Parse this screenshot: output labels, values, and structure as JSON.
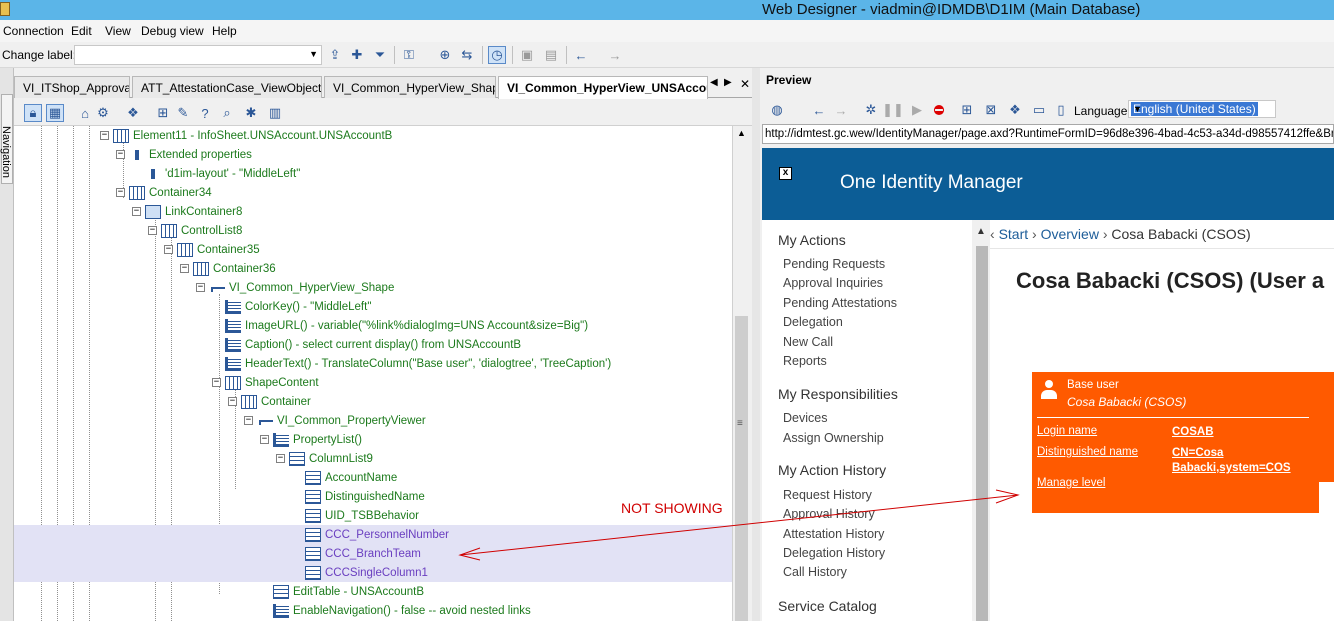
{
  "window": {
    "title": "Web Designer - viadmin@IDMDB\\D1IM (Main Database)"
  },
  "menu": {
    "items": [
      "Connection",
      "Edit",
      "View",
      "Debug view",
      "Help"
    ]
  },
  "label_row": {
    "label": "Change label:",
    "value": ""
  },
  "navigation": {
    "label": "Navigation"
  },
  "tabs": [
    {
      "label": "VI_ITShop_Approvals",
      "active": false
    },
    {
      "label": "ATT_AttestationCase_ViewObjects",
      "active": false
    },
    {
      "label": "VI_Common_HyperView_Shape",
      "active": false
    },
    {
      "label": "VI_Common_HyperView_UNSAccou",
      "active": true
    }
  ],
  "tree": [
    {
      "text": "Element11 - InfoSheet.UNSAccount.UNSAccountB",
      "icon": "grid",
      "purple": false
    },
    {
      "text": "Extended properties",
      "icon": "prop",
      "purple": false
    },
    {
      "text": "'d1im-layout' - \"MiddleLeft\"",
      "icon": "prop",
      "purple": false
    },
    {
      "text": "Container34",
      "icon": "grid",
      "purple": false
    },
    {
      "text": "LinkContainer8",
      "icon": "link",
      "purple": false
    },
    {
      "text": "ControlList8",
      "icon": "grid",
      "purple": false
    },
    {
      "text": "Container35",
      "icon": "grid",
      "purple": false
    },
    {
      "text": "Container36",
      "icon": "grid",
      "purple": false
    },
    {
      "text": "VI_Common_HyperView_Shape",
      "icon": "shape",
      "purple": false
    },
    {
      "text": "ColorKey() - \"MiddleLeft\"",
      "icon": "func",
      "purple": false
    },
    {
      "text": "ImageURL() - variable(\"%link%dialogImg=UNS Account&size=Big\")",
      "icon": "func",
      "purple": false
    },
    {
      "text": "Caption() - select current display() from UNSAccountB",
      "icon": "func",
      "purple": false
    },
    {
      "text": "HeaderText() - TranslateColumn(\"Base user\", 'dialogtree', 'TreeCaption')",
      "icon": "func",
      "purple": false
    },
    {
      "text": "ShapeContent",
      "icon": "grid",
      "purple": false
    },
    {
      "text": "Container",
      "icon": "grid",
      "purple": false
    },
    {
      "text": "VI_Common_PropertyViewer",
      "icon": "shape",
      "purple": false
    },
    {
      "text": "PropertyList()",
      "icon": "func",
      "purple": false
    },
    {
      "text": "ColumnList9",
      "icon": "col",
      "purple": false
    },
    {
      "text": "AccountName",
      "icon": "col",
      "purple": false
    },
    {
      "text": "DistinguishedName",
      "icon": "col",
      "purple": false
    },
    {
      "text": "UID_TSBBehavior",
      "icon": "col",
      "purple": false
    },
    {
      "text": "CCC_PersonnelNumber",
      "icon": "col",
      "purple": true
    },
    {
      "text": "CCC_BranchTeam",
      "icon": "col",
      "purple": true
    },
    {
      "text": "CCCSingleColumn1",
      "icon": "col",
      "purple": true
    },
    {
      "text": "EditTable - UNSAccountB",
      "icon": "col",
      "purple": false
    },
    {
      "text": "EnableNavigation() - false -- avoid nested links",
      "icon": "func",
      "purple": false
    }
  ],
  "preview": {
    "title": "Preview",
    "language_label": "Language",
    "language_value": "English (United States)",
    "url": "http://idmtest.gc.wew/IdentityManager/page.axd?RuntimeFormID=96d8e396-4bad-4c53-a34d-d98557412ffe&Branch",
    "brand": "One Identity Manager",
    "breadcrumb": {
      "start": "Start",
      "overview": "Overview",
      "current": "Cosa Babacki (CSOS)"
    },
    "heading": "Cosa Babacki (CSOS) (User a",
    "sidebar": [
      {
        "heading": "My Actions",
        "items": [
          "Pending Requests",
          "Approval Inquiries",
          "Pending Attestations",
          "Delegation",
          "New Call",
          "Reports"
        ]
      },
      {
        "heading": "My Responsibilities",
        "items": [
          "Devices",
          "Assign Ownership"
        ]
      },
      {
        "heading": "My Action History",
        "items": [
          "Request History",
          "Approval History",
          "Attestation History",
          "Delegation History",
          "Call History"
        ]
      },
      {
        "heading": "Service Catalog",
        "items": []
      }
    ],
    "card": {
      "type": "Base user",
      "name": "Cosa Babacki (CSOS)",
      "fields": [
        {
          "key": "Login name",
          "value": "COSAB"
        },
        {
          "key": "Distinguished name",
          "value": "CN=Cosa Babacki,system=COS"
        },
        {
          "key": "Manage level",
          "value": ""
        }
      ]
    }
  },
  "annotation": {
    "text": "NOT SHOWING",
    "color": "#d00000"
  },
  "colors": {
    "titlebar": "#5bb5e8",
    "banner": "#0c5d96",
    "card": "#ff5a00",
    "tree_text": "#1c7a1c",
    "tree_new": "#6a3fc0"
  }
}
